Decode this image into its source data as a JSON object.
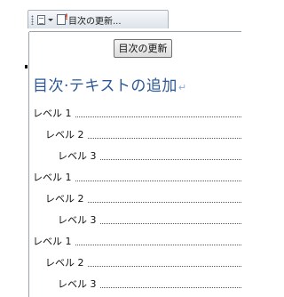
{
  "content_control": {
    "tab_label": "目次の更新..."
  },
  "update_button_label": "目次の更新",
  "toc": {
    "title": "目次·テキストの追加",
    "paragraph_mark": "↵",
    "entries": [
      {
        "text": "レベル 1",
        "level": 1
      },
      {
        "text": "レベル 2",
        "level": 2
      },
      {
        "text": "レベル 3",
        "level": 3
      },
      {
        "text": "レベル 1",
        "level": 1
      },
      {
        "text": "レベル 2",
        "level": 2
      },
      {
        "text": "レベル 3",
        "level": 3
      },
      {
        "text": "レベル 1",
        "level": 1
      },
      {
        "text": "レベル 2",
        "level": 2
      },
      {
        "text": "レベル 3",
        "level": 3
      }
    ]
  }
}
